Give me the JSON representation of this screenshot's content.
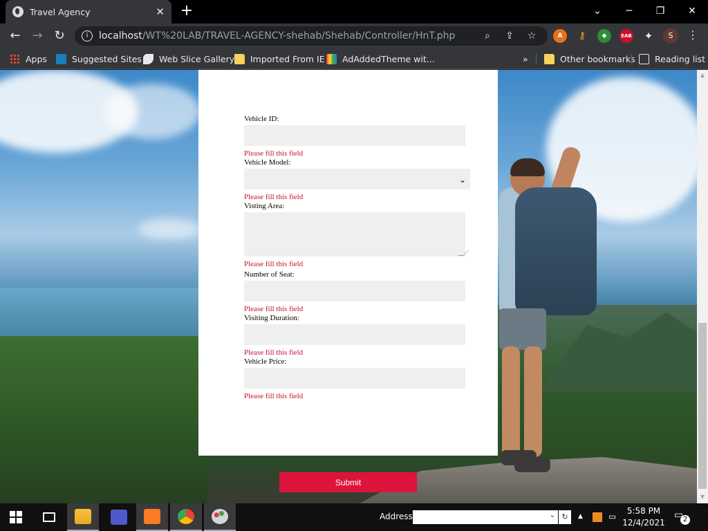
{
  "browser": {
    "tab_title": "Travel Agency",
    "tab_close": "✕",
    "new_tab": "+",
    "url_host": "localhost",
    "url_path": "/WT%20LAB/TRAVEL-AGENCY-shehab/Shehab/Controller/HnT.php",
    "profile_initial": "S",
    "window_controls": {
      "chevron": "⌄",
      "minimize": "─",
      "restore": "❐",
      "close": "✕"
    }
  },
  "bookmarks": {
    "items": [
      {
        "label": "Apps",
        "icon": "apps-grid-icon"
      },
      {
        "label": "Suggested Sites",
        "icon": "bing-icon"
      },
      {
        "label": "Web Slice Gallery",
        "icon": "web-slice-icon"
      },
      {
        "label": "Imported From IE",
        "icon": "folder-icon"
      },
      {
        "label": "AdAddedTheme wit...",
        "icon": "theme-icon"
      }
    ],
    "overflow": "»",
    "other_bookmarks": "Other bookmarks",
    "reading_list": "Reading list"
  },
  "form": {
    "fields": [
      {
        "label": "Vehicle ID:",
        "error": "Please fill this field",
        "type": "text"
      },
      {
        "label": "Vehicle Model:",
        "error": "Please fill this field",
        "type": "select"
      },
      {
        "label": "Visting Area:",
        "error": "Please fill this field",
        "type": "textarea"
      },
      {
        "label": "Number of Seat:",
        "error": "Please fill this field",
        "type": "text"
      },
      {
        "label": "Visiting Duration:",
        "error": "Please fill this field",
        "type": "text"
      },
      {
        "label": "Vehicle Price:",
        "error": "Please fill this field",
        "type": "text"
      }
    ],
    "submit_label": "Submit",
    "error_color": "#c8102e",
    "submit_color": "#dc143c"
  },
  "taskbar": {
    "address_label": "Address",
    "time": "5:58 PM",
    "date": "12/4/2021",
    "notification_count": "2",
    "apps": [
      "file-explorer-icon",
      "teams-icon",
      "xampp-icon",
      "chrome-icon",
      "paint-icon"
    ]
  }
}
